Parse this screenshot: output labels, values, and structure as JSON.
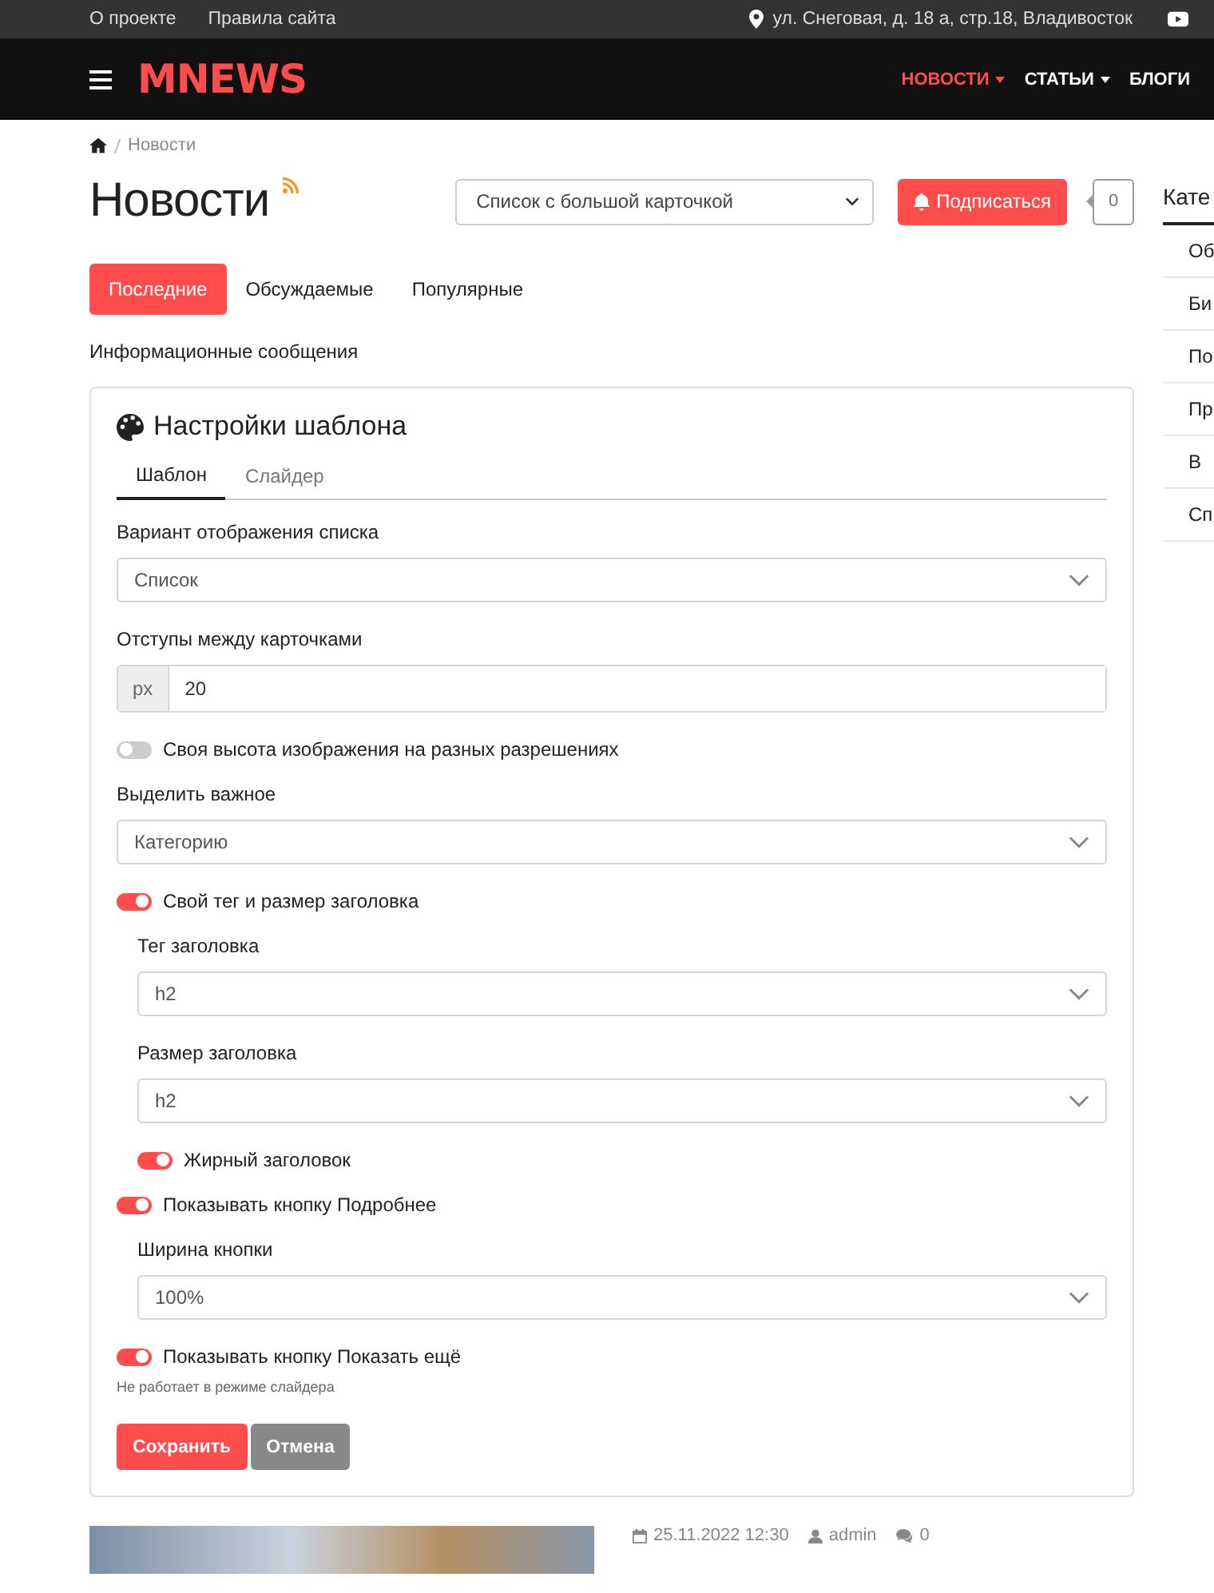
{
  "topbar": {
    "links": [
      "О проекте",
      "Правила сайта"
    ],
    "address": "ул. Снеговая, д. 18 а, стр.18, Владивосток"
  },
  "header": {
    "logo": "MNEWS",
    "nav": [
      {
        "label": "НОВОСТИ",
        "selected": true,
        "dropdown": true
      },
      {
        "label": "СТАТЬИ",
        "selected": false,
        "dropdown": true
      },
      {
        "label": "БЛОГИ",
        "selected": false,
        "dropdown": false
      }
    ]
  },
  "breadcrumb": [
    "Новости"
  ],
  "page": {
    "title": "Новости",
    "view_select": "Список с большой карточкой",
    "subscribe": "Подписаться",
    "subscribers": "0"
  },
  "tabs": [
    {
      "label": "Последние",
      "selected": true
    },
    {
      "label": "Обсуждаемые",
      "selected": false
    },
    {
      "label": "Популярные",
      "selected": false
    }
  ],
  "section_title": "Информационные сообщения",
  "settings": {
    "title": "Настройки шаблона",
    "tabs": [
      {
        "label": "Шаблон",
        "selected": true
      },
      {
        "label": "Слайдер",
        "selected": false
      }
    ],
    "fields": [
      {
        "kind": "select",
        "label": "Вариант отображения списка",
        "value": "Список"
      },
      {
        "kind": "input",
        "label": "Отступы между карточками",
        "addon": "px",
        "value": "20"
      },
      {
        "kind": "switch",
        "label": "Своя высота изображения на разных разрешениях",
        "on": false
      },
      {
        "kind": "select",
        "label": "Выделить важное",
        "value": "Категорию"
      },
      {
        "kind": "switch",
        "label": "Свой тег и размер заголовка",
        "on": true,
        "children": [
          {
            "kind": "select",
            "label": "Тег заголовка",
            "value": "h2"
          },
          {
            "kind": "select",
            "label": "Размер заголовка",
            "value": "h2"
          },
          {
            "kind": "switch",
            "label": "Жирный заголовок",
            "on": true
          }
        ]
      },
      {
        "kind": "switch",
        "label": "Показывать кнопку Подробнее",
        "on": true,
        "children": [
          {
            "kind": "select",
            "label": "Ширина кнопки",
            "value": "100%"
          }
        ]
      },
      {
        "kind": "switch",
        "label": "Показывать кнопку Показать ещё",
        "on": true,
        "hint": "Не работает в режиме слайдера"
      }
    ],
    "buttons": [
      {
        "label": "Сохранить",
        "kind": "primary"
      },
      {
        "label": "Отмена",
        "kind": "secondary"
      }
    ]
  },
  "post": {
    "date": "25.11.2022 12:30",
    "author": "admin",
    "comments": "0"
  },
  "sidebar": {
    "title": "Кате",
    "items": [
      "Об",
      "Би",
      "По",
      "Пр",
      "В",
      "Сп"
    ]
  }
}
